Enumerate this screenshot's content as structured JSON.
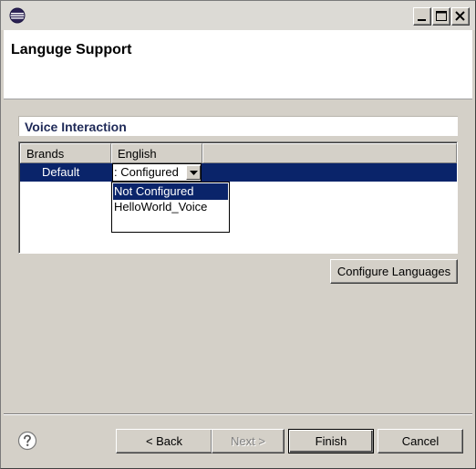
{
  "header": {
    "title": "Languge Support"
  },
  "section": {
    "title": "Voice Interaction"
  },
  "table": {
    "columns": [
      "Brands",
      "English"
    ],
    "rows": [
      {
        "brand": "Default",
        "english": ": Configured"
      }
    ]
  },
  "dropdown": {
    "options": [
      "Not Configured",
      "HelloWorld_Voice"
    ],
    "selected_index": 0
  },
  "buttons": {
    "configure_languages": "Configure Languages",
    "back": "< Back",
    "next": "Next >",
    "finish": "Finish",
    "cancel": "Cancel"
  },
  "icons": {
    "app": "eclipse-icon",
    "help": "help-icon",
    "minimize": "minimize-icon",
    "maximize": "maximize-icon",
    "close": "close-icon",
    "dropdown": "chevron-down-icon"
  },
  "colors": {
    "selection": "#0a246a",
    "section_title": "#1f2a58"
  }
}
